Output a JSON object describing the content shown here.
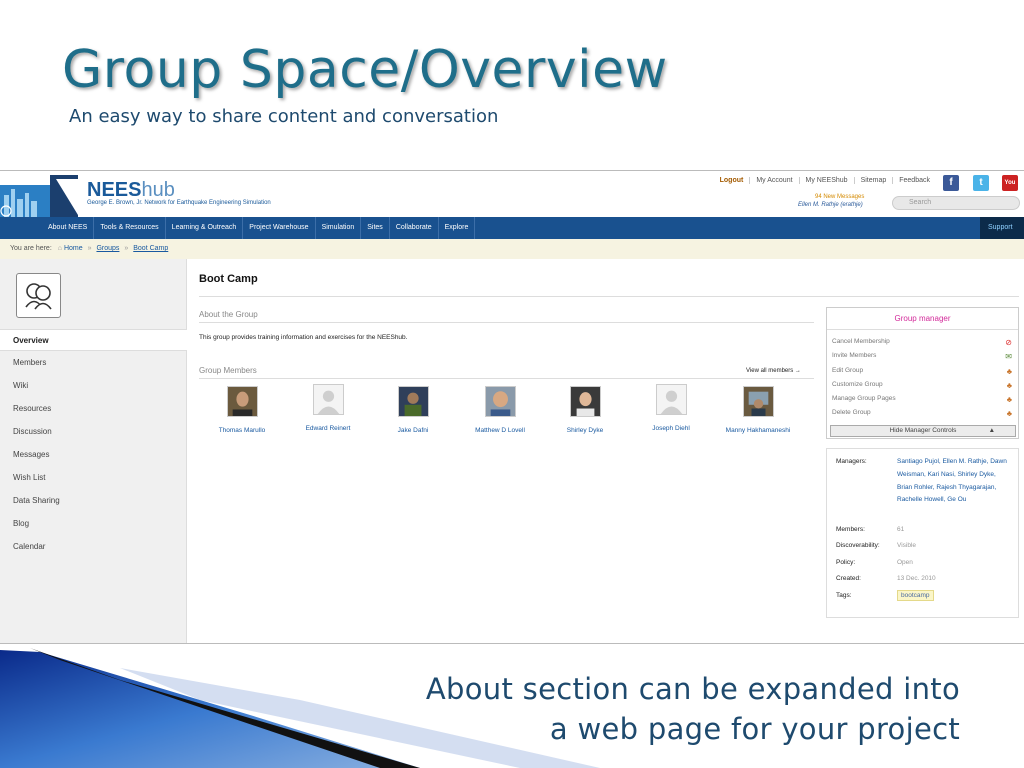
{
  "slide": {
    "title": "Group Space/Overview",
    "subtitle": "An easy way to share content and conversation",
    "caption_line1": "About section can be expanded into",
    "caption_line2": "a web page for your project"
  },
  "colors": {
    "accent": "#1f6e8a",
    "navbar": "#19518f",
    "breadcrumb_bg": "#f6f3e1",
    "manager_title": "#d32a9a"
  },
  "site": {
    "brand": "NEES",
    "brand_suffix": "hub",
    "tagline": "George E. Brown, Jr. Network for Earthquake Engineering Simulation",
    "top_links": [
      "Logout",
      "My Account",
      "My NEEShub",
      "Sitemap",
      "Feedback"
    ],
    "social": {
      "facebook": "f",
      "twitter": "t",
      "youtube": "You Tube"
    },
    "new_messages": "94 New Messages",
    "user": "Ellen M. Rathje (erathje)",
    "search_placeholder": "Search"
  },
  "nav": {
    "items": [
      "About NEES",
      "Tools & Resources",
      "Learning & Outreach",
      "Project Warehouse",
      "Simulation",
      "Sites",
      "Collaborate",
      "Explore"
    ],
    "support": "Support"
  },
  "breadcrumb": {
    "prefix": "You are here:",
    "home": "Home",
    "groups": "Groups",
    "current": "Boot Camp"
  },
  "sidebar": {
    "icon": "group-icon",
    "items": [
      "Overview",
      "Members",
      "Wiki",
      "Resources",
      "Discussion",
      "Messages",
      "Wish List",
      "Data Sharing",
      "Blog",
      "Calendar"
    ]
  },
  "main": {
    "title": "Boot Camp",
    "about_heading": "About the Group",
    "about_text": "This group provides training information and exercises for the NEEShub.",
    "members_heading": "Group Members",
    "view_all": "View all members →",
    "members": [
      {
        "name": "Thomas Marullo",
        "photo": "photo"
      },
      {
        "name": "Edward Reinert",
        "photo": "placeholder"
      },
      {
        "name": "Jake Dafni",
        "photo": "photo"
      },
      {
        "name": "Matthew D Lovell",
        "photo": "photo"
      },
      {
        "name": "Shirley Dyke",
        "photo": "photo"
      },
      {
        "name": "Joseph Diehl",
        "photo": "placeholder"
      },
      {
        "name": "Manny Hakhamaneshi",
        "photo": "photo"
      }
    ]
  },
  "group_manager": {
    "title": "Group manager",
    "items": [
      {
        "label": "Cancel Membership",
        "icon": "cancel-icon"
      },
      {
        "label": "Invite Members",
        "icon": "invite-icon"
      },
      {
        "label": "Edit Group",
        "icon": "edit-group-icon"
      },
      {
        "label": "Customize Group",
        "icon": "customize-icon"
      },
      {
        "label": "Manage Group Pages",
        "icon": "pages-icon"
      },
      {
        "label": "Delete Group",
        "icon": "delete-icon"
      }
    ],
    "hide_label": "Hide Manager Controls"
  },
  "info": {
    "managers_label": "Managers:",
    "managers_value": "Santiago Pujol, Ellen M. Rathje, Dawn Weisman, Kari Nasi, Shirley Dyke, Brian Rohler, Rajesh Thyagarajan, Rachelle Howell, Ge Ou",
    "members_label": "Members:",
    "members_value": "61",
    "discoverability_label": "Discoverability:",
    "discoverability_value": "Visible",
    "policy_label": "Policy:",
    "policy_value": "Open",
    "created_label": "Created:",
    "created_value": "13 Dec. 2010",
    "tags_label": "Tags:",
    "tag": "bootcamp"
  }
}
